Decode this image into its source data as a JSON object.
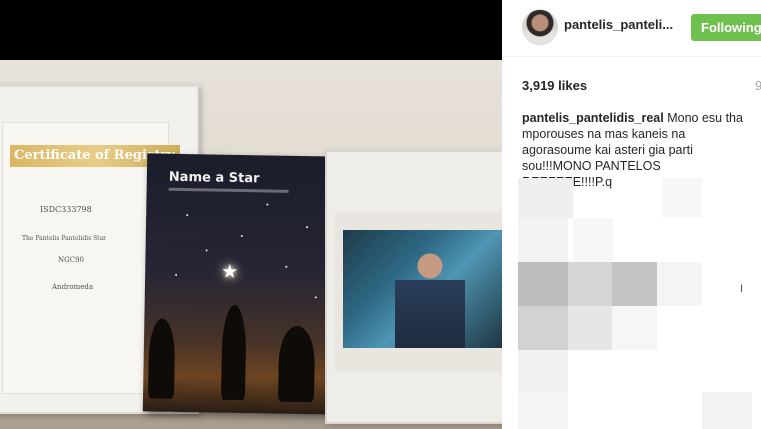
{
  "photo": {
    "book_title": "Name a Star",
    "certificate_title": "Certificate of Registry",
    "certificate_id": "ISDC333798",
    "star_name": "The Pantelis Pantelidis Star",
    "star_coord": "NGC90",
    "constellation": "Andromeda"
  },
  "post": {
    "username": "pantelis_panteli...",
    "follow_button": "Following",
    "likes": "3,919 likes",
    "time": "9",
    "caption_author": "pantelis_pantelidis_real",
    "caption_text": "Mono esu tha mporouses na mas kaneis na agorasoume kai asteri gia parti sou!!!MONO PANTELOS REEEEEE!!!!P.q",
    "side_mark": "I"
  },
  "colors": {
    "follow_green": "#70c050",
    "text_dark": "#262626",
    "muted": "#a5a5a5"
  }
}
